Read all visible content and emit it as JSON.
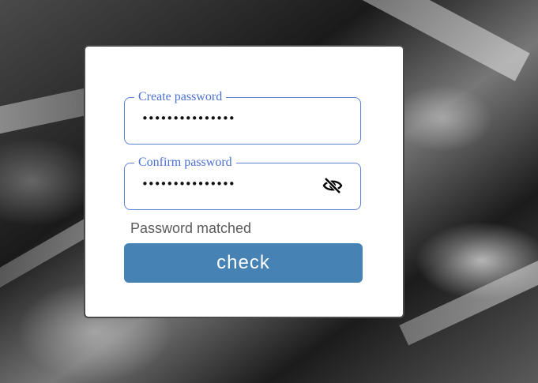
{
  "form": {
    "create_password": {
      "label": "Create password",
      "value": "•••••••••••••••"
    },
    "confirm_password": {
      "label": "Confirm password",
      "value": "•••••••••••••••",
      "toggle_icon": "eye-slash-icon"
    },
    "status_text": "Password matched",
    "submit_label": "check"
  },
  "colors": {
    "field_border": "#5a82d8",
    "label": "#4a6fd0",
    "button": "#4682b4",
    "status_text": "#5b5b5b"
  }
}
